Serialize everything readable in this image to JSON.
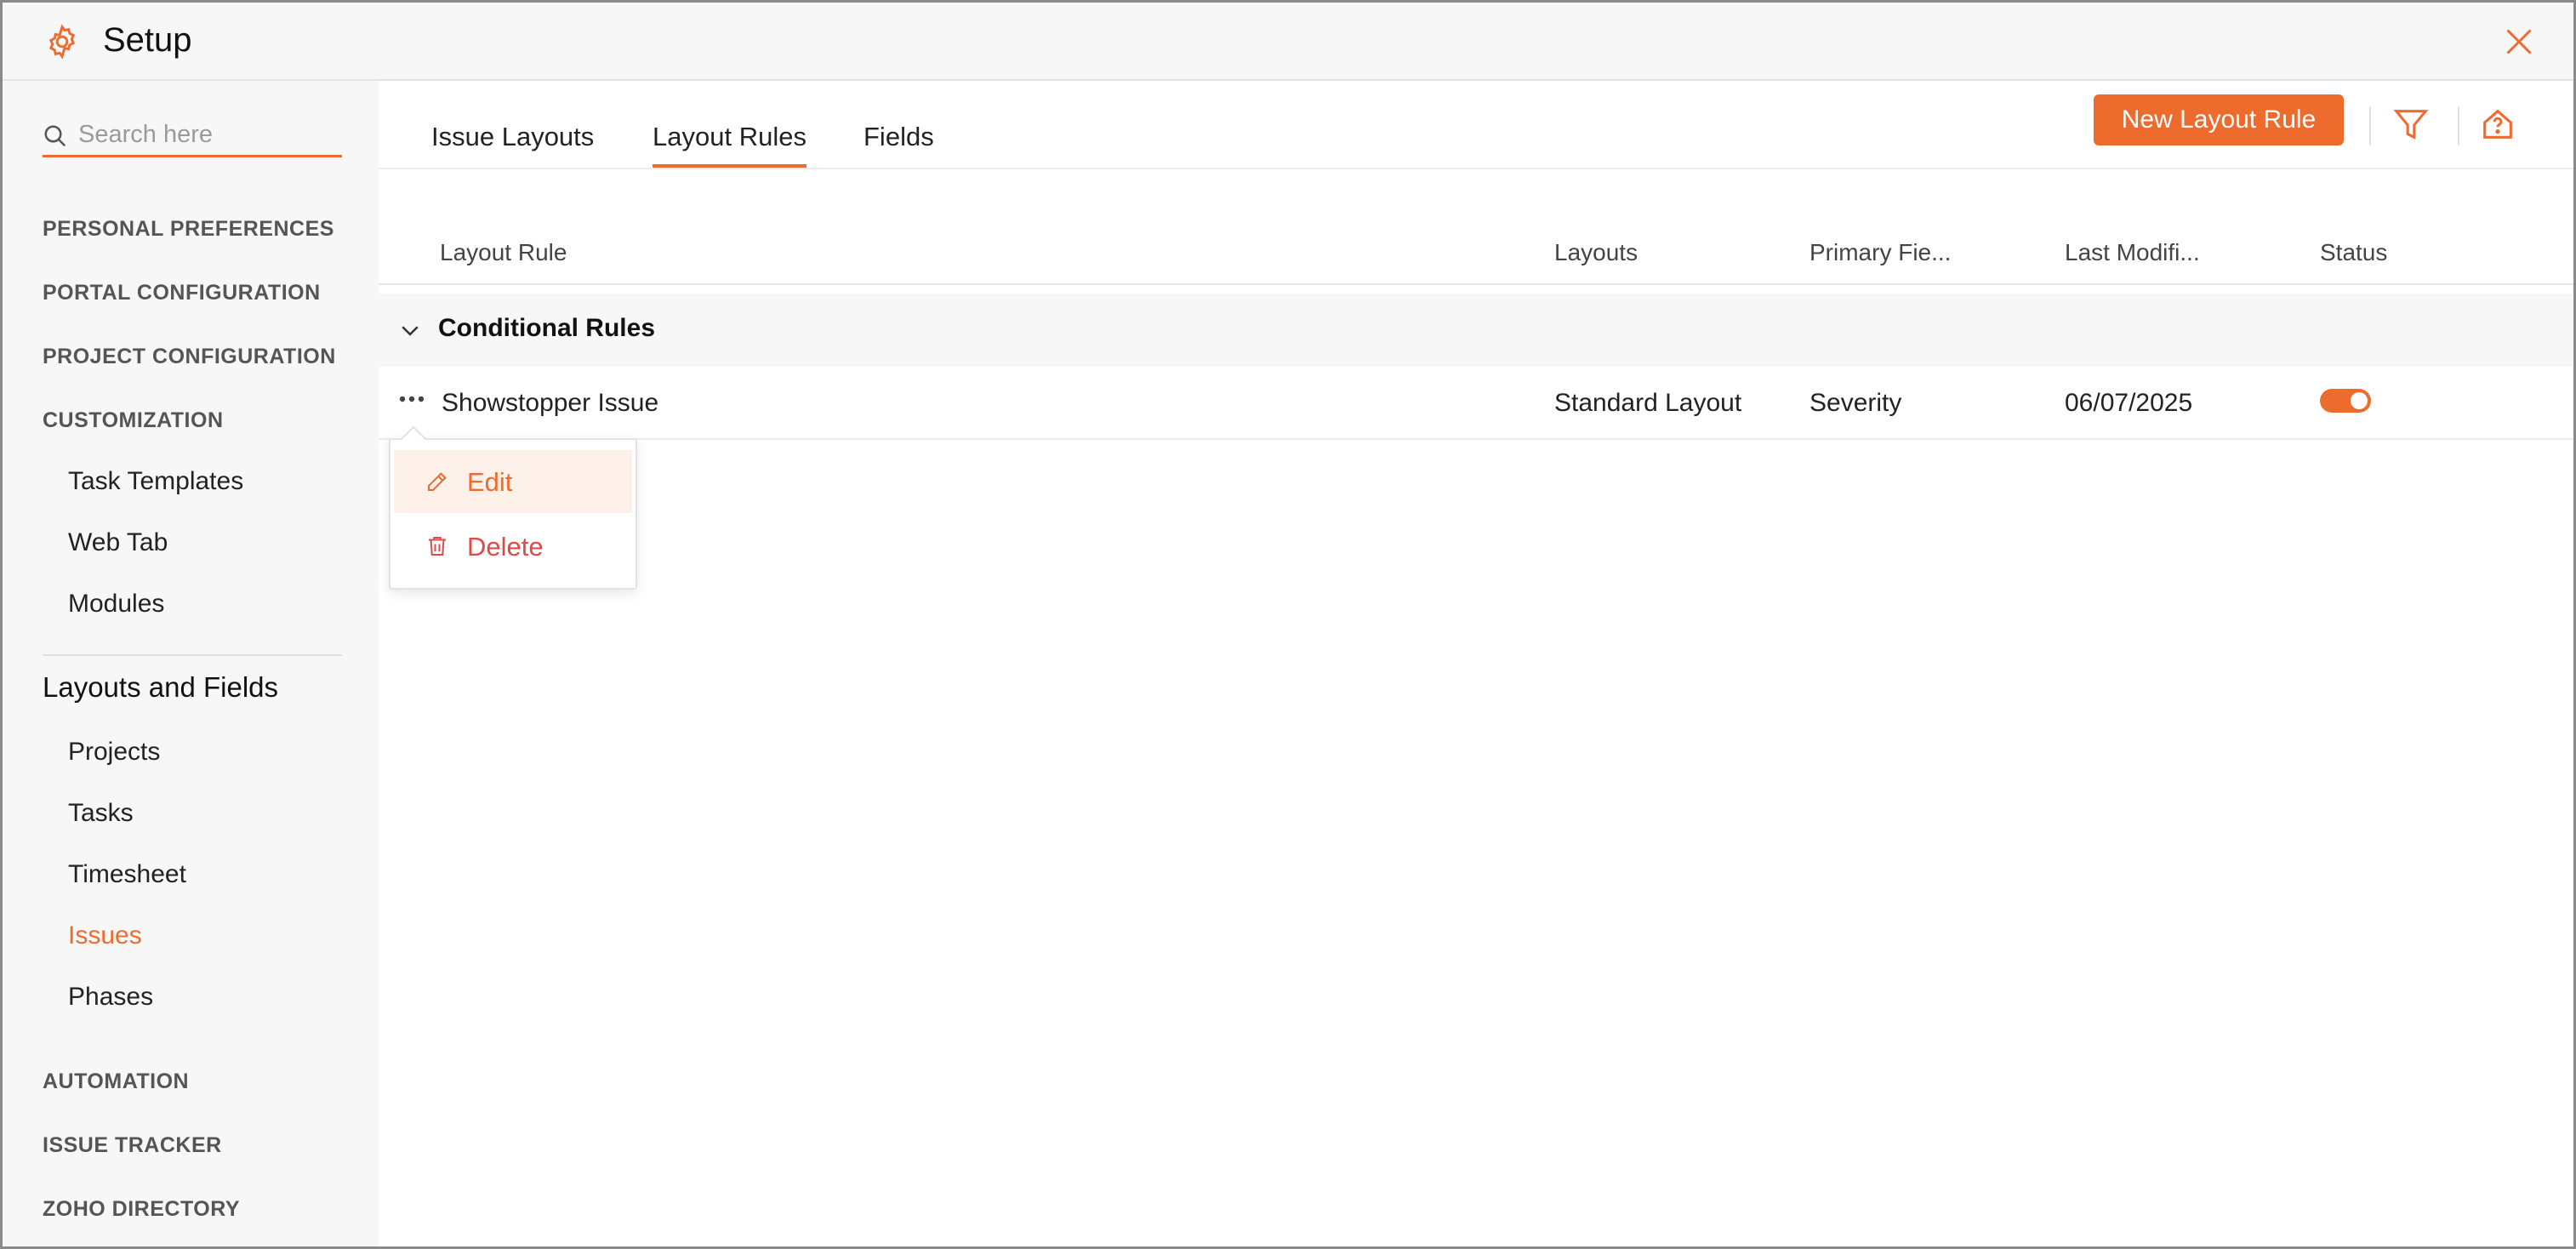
{
  "window": {
    "title": "Setup"
  },
  "sidebar": {
    "search_placeholder": "Search here",
    "sections": {
      "personal": "PERSONAL PREFERENCES",
      "portal": "PORTAL CONFIGURATION",
      "project": "PROJECT CONFIGURATION",
      "customization": "CUSTOMIZATION",
      "automation": "AUTOMATION",
      "issue_tracker": "ISSUE TRACKER",
      "zoho_directory": "ZOHO DIRECTORY"
    },
    "customization_items": [
      "Task Templates",
      "Web Tab",
      "Modules"
    ],
    "layouts_group_title": "Layouts and Fields",
    "layouts_items": [
      "Projects",
      "Tasks",
      "Timesheet",
      "Issues",
      "Phases"
    ],
    "active_item": "Issues"
  },
  "tabs": [
    "Issue Layouts",
    "Layout Rules",
    "Fields"
  ],
  "active_tab": "Layout Rules",
  "toolbar": {
    "new_button": "New Layout Rule"
  },
  "table": {
    "headers": [
      "Layout Rule",
      "Layouts",
      "Primary Fie...",
      "Last Modifi...",
      "Status"
    ],
    "group": "Conditional Rules",
    "rows": [
      {
        "rule": "Showstopper Issue",
        "layouts": "Standard Layout",
        "primary_field": "Severity",
        "last_modified": "06/07/2025",
        "status_on": true
      }
    ]
  },
  "context_menu": {
    "edit": "Edit",
    "delete": "Delete"
  },
  "colors": {
    "accent": "#ee6b2e",
    "danger": "#e24848"
  }
}
